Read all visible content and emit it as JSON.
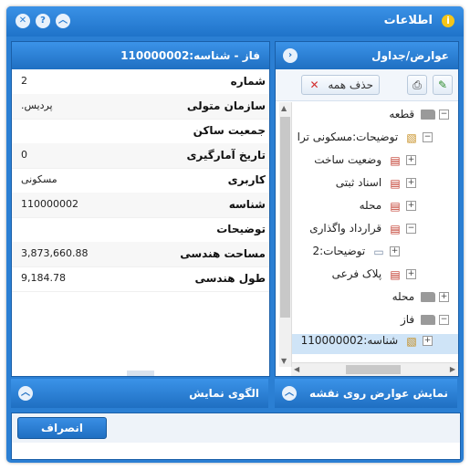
{
  "window": {
    "title": "اطلاعات",
    "info_glyph": "i",
    "close_glyph": "✕",
    "help_glyph": "?",
    "collapse_glyph": "︿"
  },
  "layers_panel": {
    "title": "عوارض/جداول",
    "collapse_glyph": "›",
    "clear_all_label": "حذف همه",
    "clear_all_glyph": "✕",
    "print_glyph": "⎙",
    "export_glyph": "✎",
    "tree": [
      {
        "label": "قطعه",
        "toggle": "−",
        "icon": "folder-icon",
        "depth": 0
      },
      {
        "label": "توضیحات:مسکونی ترا",
        "toggle": "−",
        "icon": "feature-icon",
        "depth": 1
      },
      {
        "label": "وضعیت ساخت",
        "toggle": "+",
        "icon": "layer-icon",
        "depth": 2
      },
      {
        "label": "اسناد ثبتی",
        "toggle": "+",
        "icon": "layer-icon",
        "depth": 2
      },
      {
        "label": "محله",
        "toggle": "+",
        "icon": "layer-icon",
        "depth": 2
      },
      {
        "label": "قرارداد واگذاری",
        "toggle": "−",
        "icon": "layer-icon",
        "depth": 2
      },
      {
        "label": "توضیحات:2",
        "toggle": "+",
        "icon": "document-icon",
        "depth": 3
      },
      {
        "label": "پلاک فرعی",
        "toggle": "+",
        "icon": "layer-icon",
        "depth": 2
      },
      {
        "label": "محله",
        "toggle": "+",
        "icon": "folder-icon",
        "depth": 0
      },
      {
        "label": "فاز",
        "toggle": "−",
        "icon": "folder-icon",
        "depth": 0
      },
      {
        "label": "شناسه:110000002",
        "toggle": "+",
        "icon": "feature-icon",
        "depth": 1,
        "selected": true
      }
    ]
  },
  "details_panel": {
    "title": "فاز - شناسه:110000002",
    "rows": [
      {
        "label": "شماره",
        "value": "2"
      },
      {
        "label": "سازمان متولی",
        "value": ".پردیس"
      },
      {
        "label": "جمعیت ساکن",
        "value": ""
      },
      {
        "label": "تاریخ آمارگیری",
        "value": "0"
      },
      {
        "label": "کاربری",
        "value": "مسکونی"
      },
      {
        "label": "شناسه",
        "value": "110000002"
      },
      {
        "label": "توضیحات",
        "value": ""
      },
      {
        "label": "مساحت هندسی",
        "value": "3,873,660.88"
      },
      {
        "label": "طول هندسی",
        "value": "9,184.78"
      }
    ]
  },
  "footer_panels": {
    "show_on_map_label": "نمایش عوارض روی نقشه",
    "display_pattern_label": "الگوی نمایش",
    "expand_glyph": "︿"
  },
  "actions": {
    "cancel_label": "انصراف"
  },
  "colors": {
    "accent": "#2b7fd3",
    "header_gradient_top": "#3b93e8",
    "selected_row": "#cfe4f7"
  }
}
